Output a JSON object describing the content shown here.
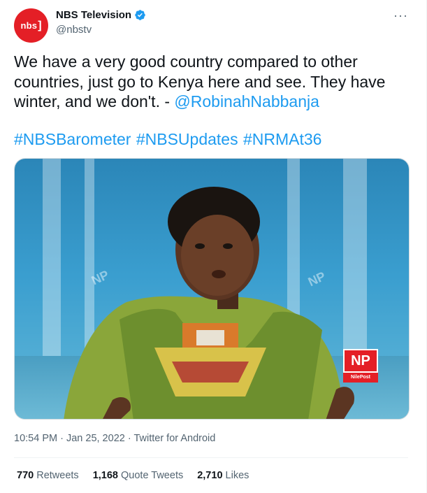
{
  "author": {
    "avatar_text": "nbs",
    "avatar_bracket": "]",
    "display_name": "NBS Television",
    "handle": "@nbstv",
    "verified_icon": "verified-badge-icon"
  },
  "more_label": "···",
  "tweet": {
    "text": "We have a very good country compared to other countries, just go to Kenya here and see. They have winter, and we don't. - ",
    "mention": "@RobinahNabbanja",
    "hashtags": "#NBSBarometer #NBSUpdates #NRMAt36"
  },
  "media": {
    "logo_main": "NP",
    "logo_sub": "NilePost",
    "watermark": "NP"
  },
  "meta": {
    "time": "10:54 PM",
    "separator1": " · ",
    "date": "Jan 25, 2022",
    "separator2": " · ",
    "source": "Twitter for Android"
  },
  "stats": {
    "retweets_count": "770",
    "retweets_label": "Retweets",
    "quotes_count": "1,168",
    "quotes_label": "Quote Tweets",
    "likes_count": "2,710",
    "likes_label": "Likes"
  },
  "colors": {
    "accent": "#1d9bf0",
    "brand_red": "#e41f26",
    "muted": "#536471"
  }
}
